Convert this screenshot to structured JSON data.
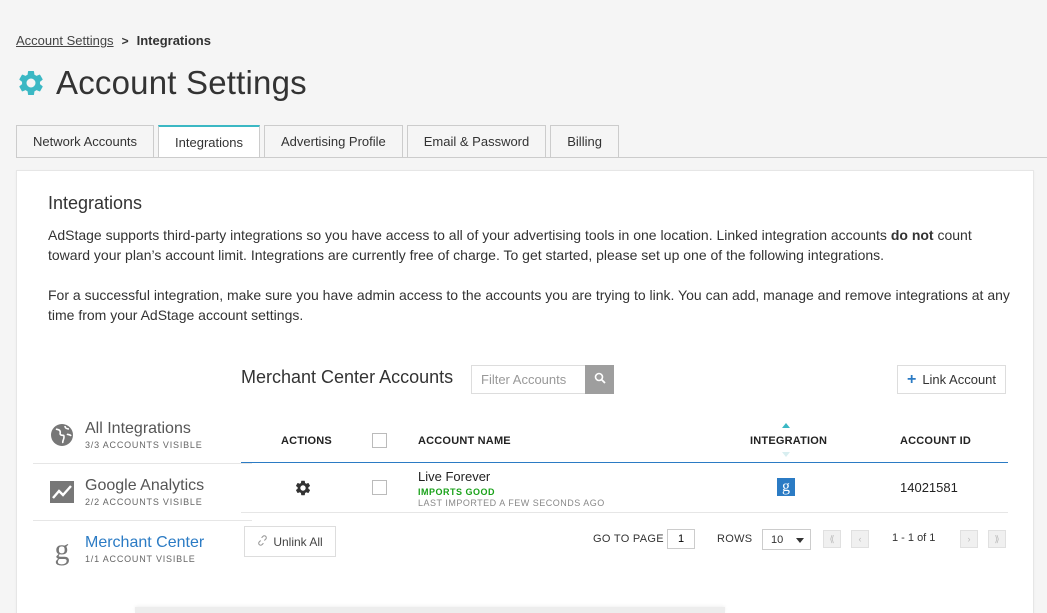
{
  "breadcrumb": {
    "link": "Account Settings",
    "separator": ">",
    "current": "Integrations"
  },
  "page": {
    "title": "Account Settings",
    "accent": "#3bb8c4"
  },
  "tabs": [
    {
      "label": "Network Accounts"
    },
    {
      "label": "Integrations",
      "active": true
    },
    {
      "label": "Advertising Profile"
    },
    {
      "label": "Email & Password"
    },
    {
      "label": "Billing"
    }
  ],
  "panel": {
    "heading": "Integrations",
    "p1_before": "AdStage supports third-party integrations so you have access to all of your advertising tools in one location. Linked integration accounts ",
    "p1_bold": "do not",
    "p1_after": " count toward your plan’s account limit. Integrations are currently free of charge. To get started, please set up one of the following integrations.",
    "p2": "For a successful integration, make sure you have admin access to the accounts you are trying to link. You can add, manage and remove integrations at any time from your AdStage account settings."
  },
  "sidebar": {
    "items": [
      {
        "label": "All Integrations",
        "sub": "3/3 ACCOUNTS VISIBLE",
        "icon": "globe-icon"
      },
      {
        "label": "Google Analytics",
        "sub": "2/2 ACCOUNTS VISIBLE",
        "icon": "analytics-icon"
      },
      {
        "label": "Merchant Center",
        "sub": "1/1 ACCOUNT VISIBLE",
        "icon": "merchant-g-icon",
        "active": true
      }
    ]
  },
  "accounts": {
    "title": "Merchant Center Accounts",
    "filter_placeholder": "Filter Accounts",
    "link_label": "Link Account",
    "link_color": "#2b7bc4"
  },
  "table": {
    "headers": {
      "actions": "ACTIONS",
      "name": "ACCOUNT NAME",
      "integration": "INTEGRATION",
      "id": "ACCOUNT ID"
    },
    "rows": [
      {
        "name": "Live Forever",
        "status": "IMPORTS GOOD",
        "imported": "LAST IMPORTED A FEW SECONDS AGO",
        "integration_glyph": "g",
        "id": "14021581"
      }
    ]
  },
  "pager": {
    "unlink_label": "Unlink All",
    "goto_label": "GO TO PAGE",
    "page_value": "1",
    "rows_label": "ROWS",
    "rows_value": "10",
    "range": "1 - 1 of 1"
  }
}
